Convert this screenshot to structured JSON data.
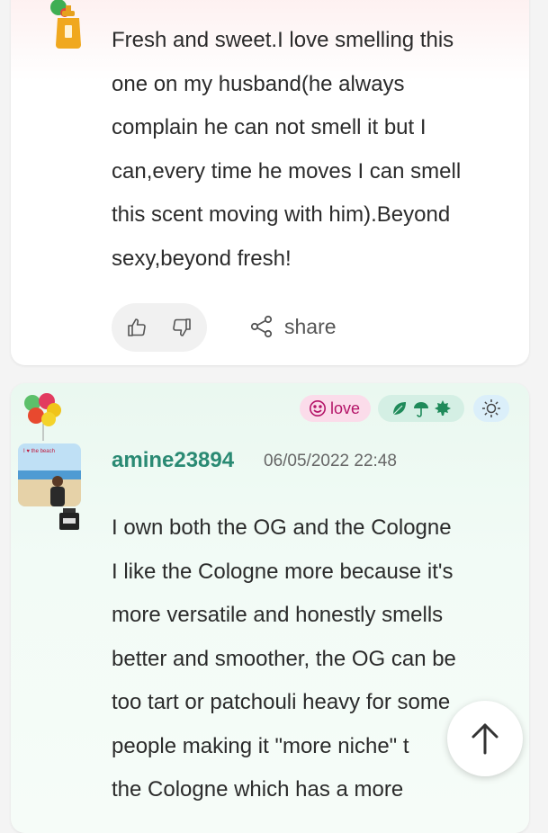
{
  "review1": {
    "text": "Fresh and sweet.I love smelling this\none on my husband(he always\ncomplain he can not smell it but I\ncan,every time he moves I can smell\nthis scent moving with him).Beyond\nsexy,beyond fresh!",
    "share_label": "share",
    "icons": {
      "perfume": "perfume-bottle-icon",
      "like": "thumbs-up-icon",
      "dislike": "thumbs-down-icon",
      "share": "share-icon"
    }
  },
  "review2": {
    "author": "amine23894",
    "timestamp": "06/05/2022 22:48",
    "tag_love": "love",
    "text": "I own both the OG and the Cologne\nI like the Cologne more because it's\nmore versatile and honestly smells\nbetter and smoother, the OG can be\ntoo tart or patchouli heavy for some\npeople making it \"more niche\" t\nthe Cologne which has a more",
    "avatar_caption": "I ❤ the beach",
    "icons": {
      "balloons": "balloons-icon",
      "love": "smile-icon",
      "seasons": [
        "leaf-icon",
        "umbrella-icon",
        "maple-leaf-icon"
      ],
      "sun": "sun-icon",
      "bottle": "perfume-bottle-icon"
    }
  },
  "scroll_top": {
    "icon": "arrow-up-icon"
  },
  "colors": {
    "author": "#2a8a73",
    "love_tag_bg": "#fbdcea",
    "love_tag_text": "#b41468",
    "season_tag_bg": "#d4efe4",
    "sun_tag_bg": "#dbeffa"
  }
}
